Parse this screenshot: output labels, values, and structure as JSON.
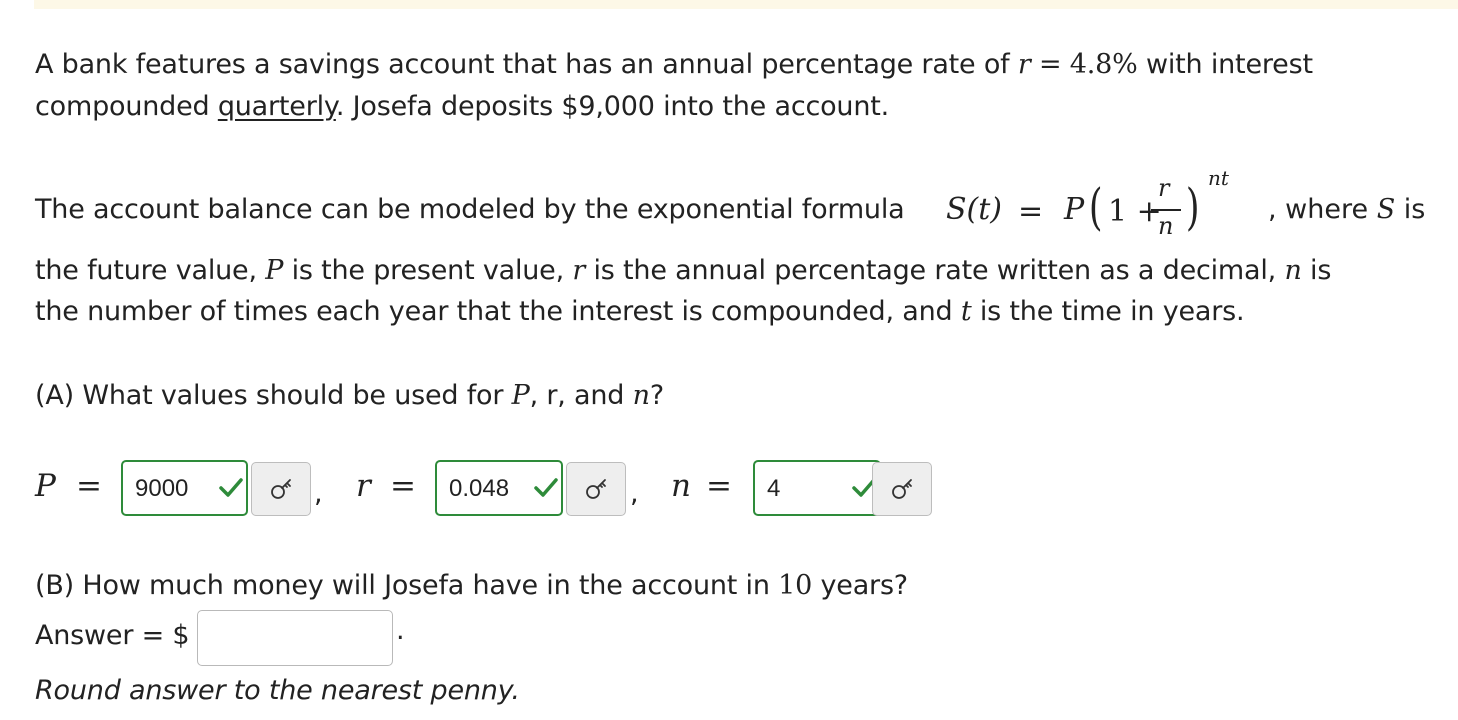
{
  "intro": {
    "line1_text": "A bank features a savings account that has an annual percentage rate of ",
    "rate_var": "r",
    "rate_eq": "= 4.8%",
    "line1_tail": " with interest",
    "line2_prefix": "compounded ",
    "compounding_word": "quarterly",
    "line2_suffix": ". Josefa deposits $9,000 into the account."
  },
  "model": {
    "lead": "The account balance can be modeled by the exponential formula ",
    "formula": {
      "lhs": "S(t)",
      "eq": "=",
      "P": "P",
      "lparen": "(",
      "one_plus": "1 +",
      "num": "r",
      "den": "n",
      "rparen": ")",
      "exponent": "nt"
    },
    "after_formula": ", where ",
    "after_var": "S",
    "after_tail": " is",
    "line2_a": "the future value, ",
    "line2_P": "P",
    "line2_b": " is the present value, ",
    "line2_r": "r",
    "line2_c": " is the annual percentage rate written as a decimal, ",
    "line2_n": "n",
    "line2_d": " is",
    "line3_a": "the number of times each year that the interest is compounded, and ",
    "line3_t": "t",
    "line3_b": " is the time in years."
  },
  "part_a": {
    "q_a": "(A) What values should be used for ",
    "q_P": "P",
    "q_b": ", r, and ",
    "q_n": "n",
    "q_c": "?",
    "fields": [
      {
        "var": "P",
        "eq": "=",
        "value": "9000",
        "status": "correct"
      },
      {
        "var": "r",
        "eq": "=",
        "value": "0.048",
        "status": "correct"
      },
      {
        "var": "n",
        "eq": "=",
        "value": "4",
        "status": "correct"
      }
    ],
    "comma": ","
  },
  "part_b": {
    "q_a": "(B) How much money will Josefa have in the account in ",
    "q_years": "10",
    "q_b": " years?",
    "answer_label": "Answer = $",
    "answer_value": "",
    "answer_period": ".",
    "round_note": "Round answer to the nearest penny."
  },
  "colors": {
    "correct": "#2e8b3a",
    "text": "#222222",
    "banner": "#fdf8e7",
    "key_button_bg": "#eeeeee"
  },
  "icons": [
    "check-icon",
    "key-icon"
  ]
}
